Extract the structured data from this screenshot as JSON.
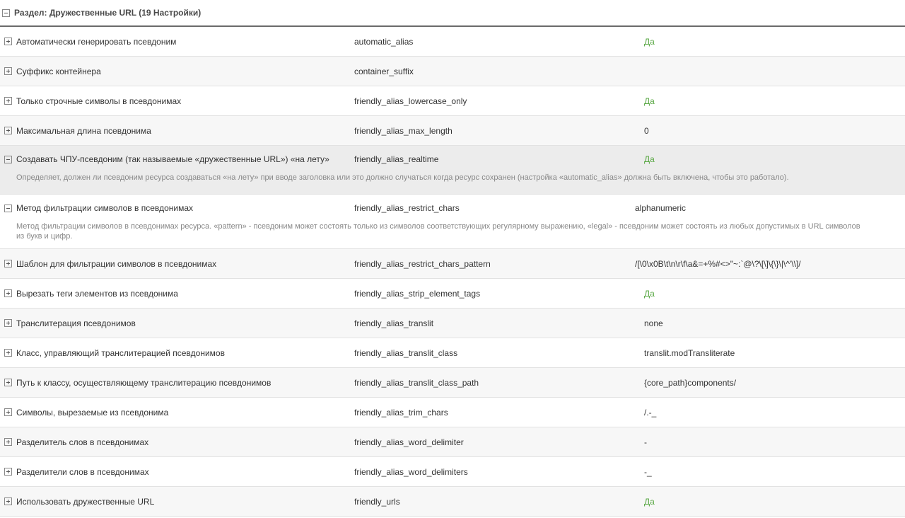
{
  "group": {
    "title": "Раздел: Дружественные URL (19 Настройки)"
  },
  "rows": [
    {
      "name": "Автоматически генерировать псевдоним",
      "key": "automatic_alias",
      "value": "Да"
    },
    {
      "name": "Суффикс контейнера",
      "key": "container_suffix",
      "value": ""
    },
    {
      "name": "Только строчные символы в псевдонимах",
      "key": "friendly_alias_lowercase_only",
      "value": "Да"
    },
    {
      "name": "Максимальная длина псевдонима",
      "key": "friendly_alias_max_length",
      "value": "0"
    },
    {
      "name": "Создавать ЧПУ-псевдоним (так называемые «дружественные URL») «на лету»",
      "key": "friendly_alias_realtime",
      "value": "Да",
      "description": [
        "Определяет, должен ли псевдоним ресурса создаваться «на лету» при вводе заголовка или это должно случаться когда ресурс сохранен (настройка «automatic_alias» должна быть включена, чтобы это работало)."
      ]
    },
    {
      "name": "Метод фильтрации символов в псевдонимах",
      "key": "friendly_alias_restrict_chars",
      "value": "alphanumeric",
      "description": [
        "Метод фильтрации символов в псевдонимах ресурса. «pattern» - псевдоним может состоять только из символов соответствующих регулярному выражению, «legal» - псевдоним может состоять из любых допустимых в URL символов",
        "из букв и цифр."
      ]
    },
    {
      "name": "Шаблон для фильтрации символов в псевдонимах",
      "key": "friendly_alias_restrict_chars_pattern",
      "value": "/[\\0\\x0B\\t\\n\\r\\f\\a&=+%#<>\"~:`@\\?\\[\\]\\{\\}\\|\\^'\\\\]/"
    },
    {
      "name": "Вырезать теги элементов из псевдонима",
      "key": "friendly_alias_strip_element_tags",
      "value": "Да"
    },
    {
      "name": "Транслитерация псевдонимов",
      "key": "friendly_alias_translit",
      "value": "none"
    },
    {
      "name": "Класс, управляющий транслитерацией псевдонимов",
      "key": "friendly_alias_translit_class",
      "value": "translit.modTransliterate"
    },
    {
      "name": "Путь к классу, осуществляющему транслитерацию псевдонимов",
      "key": "friendly_alias_translit_class_path",
      "value": "{core_path}components/"
    },
    {
      "name": "Символы, вырезаемые из псевдонима",
      "key": "friendly_alias_trim_chars",
      "value": "/.-_"
    },
    {
      "name": "Разделитель слов в псевдонимах",
      "key": "friendly_alias_word_delimiter",
      "value": "-"
    },
    {
      "name": "Разделители слов в псевдонимах",
      "key": "friendly_alias_word_delimiters",
      "value": "-_"
    },
    {
      "name": "Использовать дружественные URL",
      "key": "friendly_urls",
      "value": "Да"
    }
  ],
  "colors": {
    "yes": "#5aa845",
    "description": "#888888",
    "header_border": "#6b6b6b"
  }
}
